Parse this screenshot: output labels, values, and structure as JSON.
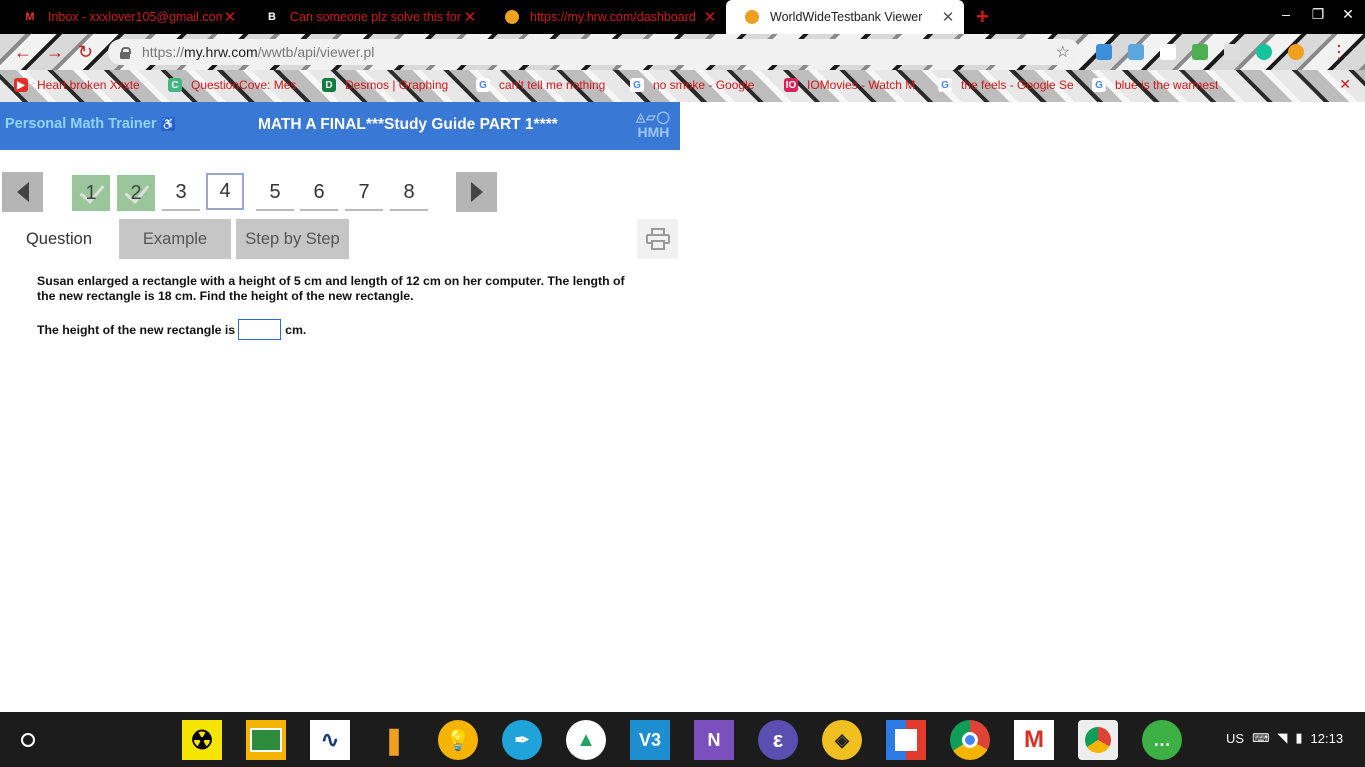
{
  "browser": {
    "tabs": [
      {
        "title": "Inbox - xxxlover105@gmail.com",
        "icon": "gmail-icon",
        "active": false
      },
      {
        "title": "Can someone plz solve this for",
        "icon": "brainly-icon",
        "active": false
      },
      {
        "title": "https://my.hrw.com/dashboard",
        "icon": "hrw-icon",
        "active": false
      },
      {
        "title": "WorldWideTestbank Viewer",
        "icon": "hrw-icon",
        "active": true
      }
    ],
    "url_prefix": "https://",
    "url_host": "my.hrw.com",
    "url_path": "/wwtb/api/viewer.pl",
    "bookmarks": [
      {
        "label": "Heart broken Xxxte",
        "icon": "youtube-icon",
        "color": "#e52d27"
      },
      {
        "label": "QuestionCove: Mes",
        "icon": "questioncove-icon",
        "color": "#43b581"
      },
      {
        "label": "Desmos | Graphing",
        "icon": "desmos-icon",
        "color": "#127d3f"
      },
      {
        "label": "can't tell me nothing",
        "icon": "google-icon",
        "color": "#4285f4"
      },
      {
        "label": "no smoke - Google",
        "icon": "google-icon",
        "color": "#4285f4"
      },
      {
        "label": "IOMovies - Watch M",
        "icon": "iomovies-icon",
        "color": "#d6245b"
      },
      {
        "label": "the feels - Google Se",
        "icon": "google-icon",
        "color": "#4285f4"
      },
      {
        "label": "blue is the warmest",
        "icon": "google-icon",
        "color": "#4285f4"
      }
    ]
  },
  "pmt": {
    "brand": "Personal Math Trainer",
    "title": "MATH A FINAL***Study Guide PART 1****",
    "logo": "HMH"
  },
  "question_nav": {
    "numbers": [
      "1",
      "2",
      "3",
      "4",
      "5",
      "6",
      "7",
      "8"
    ],
    "completed": [
      "1",
      "2"
    ],
    "current": "4"
  },
  "tabs": {
    "question": "Question",
    "example": "Example",
    "step_by_step": "Step by Step"
  },
  "problem": {
    "text": "Susan enlarged a rectangle with a height of 5 cm and length of 12 cm on her computer. The length of the new rectangle is 18 cm. Find the height of the new rectangle.",
    "answer_prefix": "The height of the new rectangle is",
    "answer_value": "",
    "answer_unit": "cm."
  },
  "shelf": {
    "apps": [
      "radiation-app-icon",
      "google-classroom-icon",
      "desmos-app-icon",
      "ink-app-icon",
      "keep-icon",
      "pen-app-icon",
      "google-drive-icon",
      "v3-app-icon",
      "onenote-icon",
      "edge-icon",
      "app-icon",
      "google-tasks-icon",
      "chrome-icon",
      "gmail-app-icon",
      "chrome-canary-icon",
      "messages-icon"
    ],
    "locale": "US",
    "time": "12:13"
  }
}
